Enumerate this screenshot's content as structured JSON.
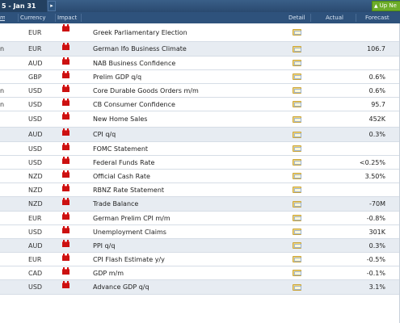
{
  "nav": {
    "date_range": "5 - Jan 31",
    "next_arrow": "▸",
    "up_next_label": "Up Ne",
    "up_next_icon": "▲"
  },
  "header": {
    "time": "m",
    "currency": "Currency",
    "impact": "Impact",
    "detail": "Detail",
    "actual": "Actual",
    "forecast": "Forecast"
  },
  "colors": {
    "header_bg": "#2e527c",
    "alt_row": "#e7ecf2",
    "impact_high": "#cc1111",
    "up_next_green": "#6dac2a"
  },
  "rows": [
    {
      "time": "",
      "currency": "EUR",
      "event": "Greek Parliamentary Election",
      "actual": "",
      "forecast": "",
      "alt": false
    },
    {
      "time": "n",
      "currency": "EUR",
      "event": "German Ifo Business Climate",
      "actual": "",
      "forecast": "106.7",
      "alt": true
    },
    {
      "time": "",
      "currency": "AUD",
      "event": "NAB Business Confidence",
      "actual": "",
      "forecast": "",
      "alt": false
    },
    {
      "time": "",
      "currency": "GBP",
      "event": "Prelim GDP q/q",
      "actual": "",
      "forecast": "0.6%",
      "alt": false
    },
    {
      "time": "n",
      "currency": "USD",
      "event": "Core Durable Goods Orders m/m",
      "actual": "",
      "forecast": "0.6%",
      "alt": false
    },
    {
      "time": "n",
      "currency": "USD",
      "event": "CB Consumer Confidence",
      "actual": "",
      "forecast": "95.7",
      "alt": false
    },
    {
      "time": "",
      "currency": "USD",
      "event": "New Home Sales",
      "actual": "",
      "forecast": "452K",
      "alt": false
    },
    {
      "time": "",
      "currency": "AUD",
      "event": "CPI q/q",
      "actual": "",
      "forecast": "0.3%",
      "alt": true
    },
    {
      "time": "",
      "currency": "USD",
      "event": "FOMC Statement",
      "actual": "",
      "forecast": "",
      "alt": false
    },
    {
      "time": "",
      "currency": "USD",
      "event": "Federal Funds Rate",
      "actual": "",
      "forecast": "<0.25%",
      "alt": false
    },
    {
      "time": "",
      "currency": "NZD",
      "event": "Official Cash Rate",
      "actual": "",
      "forecast": "3.50%",
      "alt": false
    },
    {
      "time": "",
      "currency": "NZD",
      "event": "RBNZ Rate Statement",
      "actual": "",
      "forecast": "",
      "alt": false
    },
    {
      "time": "",
      "currency": "NZD",
      "event": "Trade Balance",
      "actual": "",
      "forecast": "-70M",
      "alt": true
    },
    {
      "time": "",
      "currency": "EUR",
      "event": "German Prelim CPI m/m",
      "actual": "",
      "forecast": "-0.8%",
      "alt": false
    },
    {
      "time": "",
      "currency": "USD",
      "event": "Unemployment Claims",
      "actual": "",
      "forecast": "301K",
      "alt": false
    },
    {
      "time": "",
      "currency": "AUD",
      "event": "PPI q/q",
      "actual": "",
      "forecast": "0.3%",
      "alt": true
    },
    {
      "time": "",
      "currency": "EUR",
      "event": "CPI Flash Estimate y/y",
      "actual": "",
      "forecast": "-0.5%",
      "alt": false
    },
    {
      "time": "",
      "currency": "CAD",
      "event": "GDP m/m",
      "actual": "",
      "forecast": "-0.1%",
      "alt": false
    },
    {
      "time": "",
      "currency": "USD",
      "event": "Advance GDP q/q",
      "actual": "",
      "forecast": "3.1%",
      "alt": true
    }
  ]
}
